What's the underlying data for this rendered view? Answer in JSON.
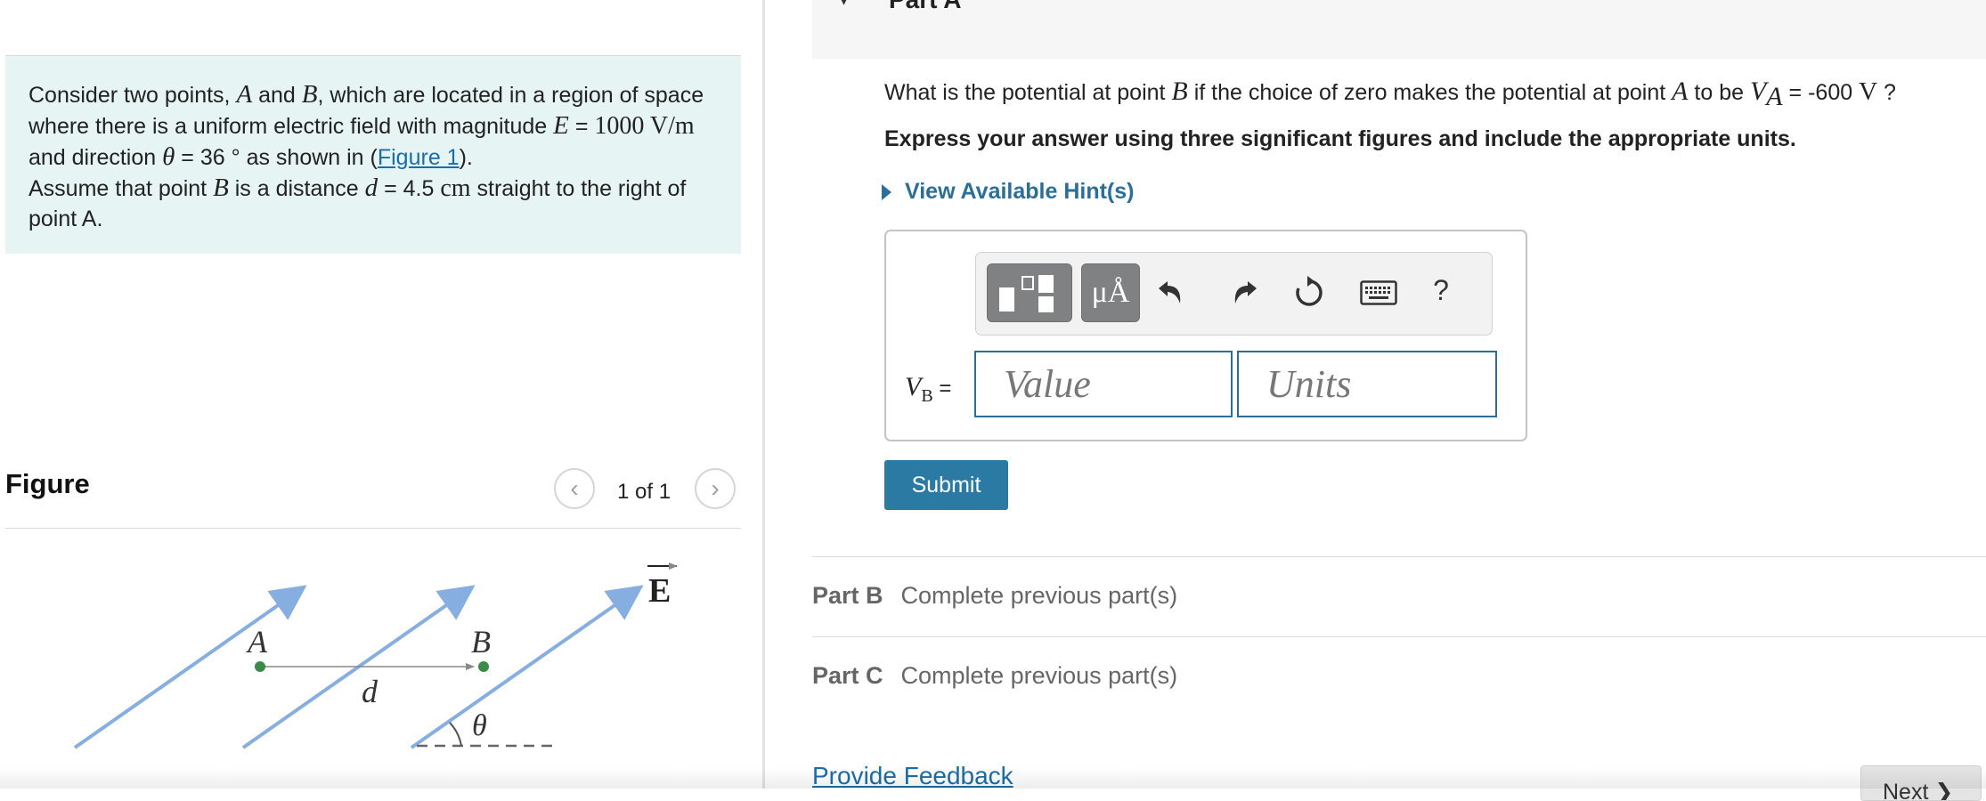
{
  "problem": {
    "t1": "Consider two points, ",
    "A": "A",
    "t2": " and ",
    "B": "B",
    "t3": ", which are located in a region of space where there is a uniform electric field with magnitude ",
    "E": "E",
    "eq": " = ",
    "E_val": "1000 ",
    "E_unit": "V/m",
    "t4": "  and direction ",
    "theta": "θ",
    "theta_val": " = 36 ° ",
    "t5": " as shown in (",
    "fig_link": "Figure 1",
    "t6": ").",
    "t7": " Assume that point ",
    "B2": "B",
    "t8": " is a distance ",
    "d": "d",
    "d_val": " = 4.5 ",
    "d_unit": "cm",
    "t9": "  straight to the right of point A."
  },
  "figure": {
    "title": "Figure",
    "counter": "1 of 1",
    "prev_glyph": "‹",
    "next_glyph": "›",
    "label_A": "A",
    "label_B": "B",
    "label_d": "d",
    "label_theta": "θ",
    "label_E": "E",
    "field_color": "#87aee0",
    "point_color": "#3b8a4a"
  },
  "part_a": {
    "title": "Part A",
    "q1": "What is the potential at point ",
    "qB": "B",
    "q2": " if the choice of zero makes the potential at point ",
    "qA": "A",
    "q3": " to be ",
    "qV": "V",
    "qVsub": "A",
    "q4": " = -600 ",
    "qUnit": "V",
    "q5": " ?",
    "instructions": "Express your answer using three significant figures and include the appropriate units.",
    "hint_label": "View Available Hint(s)",
    "toolbar": {
      "units_button": "μÅ",
      "help": "?",
      "icons": [
        "templates-icon",
        "units-icon",
        "undo-icon",
        "redo-icon",
        "reset-icon",
        "keyboard-icon",
        "help-icon"
      ]
    },
    "answer_label": "V",
    "answer_sub": "B",
    "answer_eq": " =",
    "value_placeholder": "Value",
    "units_placeholder": "Units",
    "submit_label": "Submit"
  },
  "parts": [
    {
      "label": "Part B",
      "status": "Complete previous part(s)"
    },
    {
      "label": "Part C",
      "status": "Complete previous part(s)"
    }
  ],
  "footer": {
    "feedback_link": "Provide Feedback",
    "next_label": "Next ❯"
  },
  "colors": {
    "accent": "#2a6e99",
    "submit": "#2a7aa3",
    "problem_bg": "#e6f4f3",
    "link": "#1a6ea8"
  }
}
